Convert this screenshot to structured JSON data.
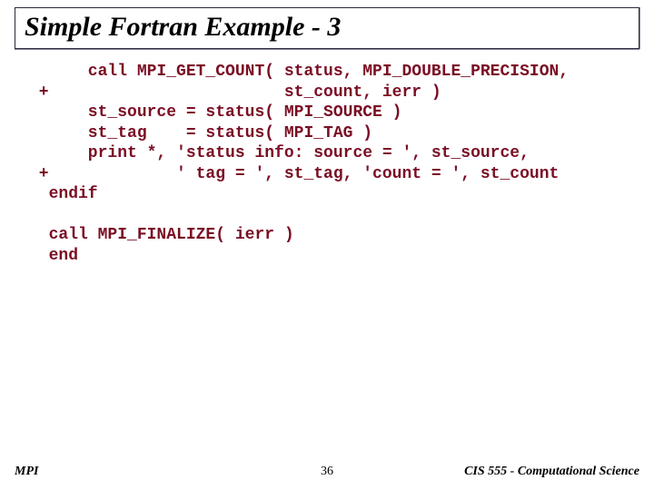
{
  "title": "Simple Fortran Example - 3",
  "code": "      call MPI_GET_COUNT( status, MPI_DOUBLE_PRECISION,\n +                        st_count, ierr )\n      st_source = status( MPI_SOURCE )\n      st_tag    = status( MPI_TAG )\n      print *, 'status info: source = ', st_source,\n +             ' tag = ', st_tag, 'count = ', st_count\n  endif\n\n  call MPI_FINALIZE( ierr )\n  end",
  "footer": {
    "left": "MPI",
    "center": "36",
    "right": "CIS 555 - Computational Science"
  }
}
